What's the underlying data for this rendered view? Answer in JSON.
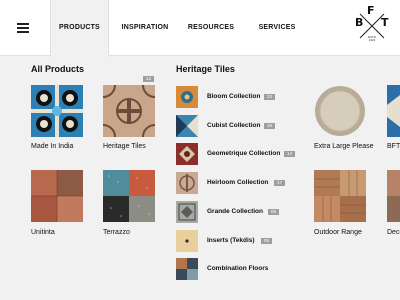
{
  "nav": {
    "tabs": [
      {
        "label": "PRODUCTS",
        "active": true
      },
      {
        "label": "INSPIRATION",
        "active": false
      },
      {
        "label": "RESOURCES",
        "active": false
      },
      {
        "label": "SERVICES",
        "active": false
      }
    ],
    "logo": {
      "letters": [
        "B",
        "F",
        "T"
      ],
      "est_line1": "ESTD",
      "est_line2": "1922"
    }
  },
  "all_products": {
    "heading": "All Products",
    "items": [
      {
        "label": "Made In India",
        "icon": "blue-patterned-tile"
      },
      {
        "label": "Heritage Tiles",
        "badge": "12",
        "icon": "heritage-tile"
      },
      {
        "label": "Unitinta",
        "icon": "terracotta-tile"
      },
      {
        "label": "Terrazzo",
        "icon": "terrazzo-tile"
      }
    ]
  },
  "heritage_tiles": {
    "heading": "Heritage Tiles",
    "items": [
      {
        "label": "Bloom Collection",
        "badge": "23"
      },
      {
        "label": "Cubist Collection",
        "badge": "16"
      },
      {
        "label": "Geometrique Collection",
        "badge": "14"
      },
      {
        "label": "Heirloom Collection",
        "badge": "17"
      },
      {
        "label": "Grande Collection",
        "badge": "08"
      },
      {
        "label": "Inserts (Tekdis)",
        "badge": "05"
      },
      {
        "label": "Combination Floors",
        "badge": ""
      }
    ]
  },
  "right_products": {
    "items": [
      {
        "label": "Extra Large Please"
      },
      {
        "label": "BFT+"
      },
      {
        "label": "Outdoor Range"
      },
      {
        "label": "Deco"
      }
    ]
  },
  "colors": {
    "background": "#f1f1f1",
    "nav_background": "#ffffff",
    "badge": "#9e9e9e",
    "text": "#111111"
  }
}
